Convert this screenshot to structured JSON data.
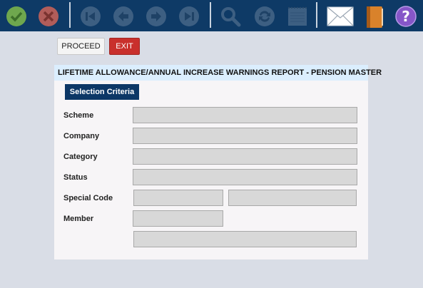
{
  "toolbar": {
    "icons": [
      {
        "name": "confirm-check-icon",
        "color": "#6fa74e"
      },
      {
        "name": "cancel-x-icon",
        "color": "#b15d5a"
      },
      {
        "name": "first-record-icon"
      },
      {
        "name": "previous-record-icon"
      },
      {
        "name": "next-record-icon"
      },
      {
        "name": "last-record-icon"
      },
      {
        "name": "search-icon"
      },
      {
        "name": "refresh-icon"
      },
      {
        "name": "notepad-icon"
      },
      {
        "name": "mail-icon"
      },
      {
        "name": "address-book-icon"
      },
      {
        "name": "help-icon"
      }
    ],
    "background": "#0e3a66",
    "disabled_icon_color": "#3d5f82"
  },
  "actions": {
    "proceed_label": "PROCEED",
    "exit_label": "EXIT"
  },
  "report": {
    "title": "LIFETIME ALLOWANCE/ANNUAL INCREASE WARNINGS REPORT - PENSION MASTER",
    "section_tab": "Selection Criteria"
  },
  "form": {
    "scheme_label": "Scheme",
    "company_label": "Company",
    "category_label": "Category",
    "status_label": "Status",
    "special_code_label": "Special Code",
    "member_label": "Member",
    "scheme_value": "",
    "company_value": "",
    "category_value": "",
    "status_value": "",
    "special_code_value": "",
    "special_code_desc_value": "",
    "member_value": "",
    "member_name_value": ""
  }
}
